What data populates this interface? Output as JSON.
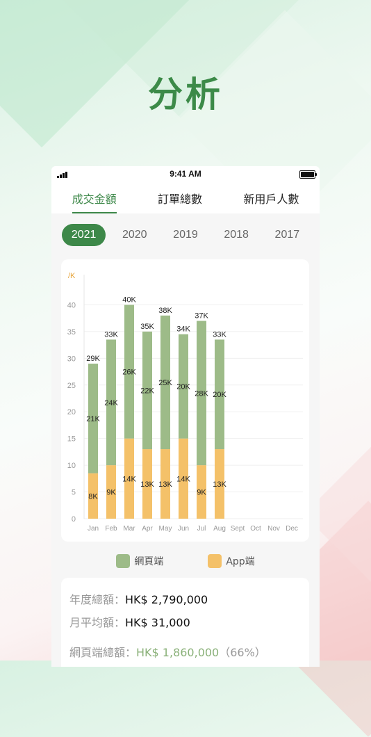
{
  "hero_title": "分析",
  "status": {
    "time": "9:41 AM"
  },
  "tabs": [
    "成交金額",
    "訂單總數",
    "新用戶人數"
  ],
  "active_tab": 0,
  "years": [
    "2021",
    "2020",
    "2019",
    "2018",
    "2017"
  ],
  "active_year": 0,
  "colors": {
    "accent": "#3d8849",
    "web": "#9dbb88",
    "app": "#f4c169"
  },
  "chart_data": {
    "type": "bar",
    "stacked": true,
    "unit_label": "/K",
    "categories": [
      "Jan",
      "Feb",
      "Mar",
      "Apr",
      "May",
      "Jun",
      "Jul",
      "Aug",
      "Sept",
      "Oct",
      "Nov",
      "Dec"
    ],
    "series": [
      {
        "name": "App端",
        "values": [
          8.5,
          10,
          15,
          13,
          13,
          15,
          10,
          13,
          null,
          null,
          null,
          null
        ],
        "labels": [
          "8K",
          "9K",
          "14K",
          "13K",
          "13K",
          "14K",
          "9K",
          "13K"
        ]
      },
      {
        "name": "網頁端",
        "values": [
          20.5,
          23.5,
          25,
          22,
          25,
          19.5,
          27,
          20.5,
          null,
          null,
          null,
          null
        ],
        "labels": [
          "21K",
          "24K",
          "26K",
          "22K",
          "25K",
          "20K",
          "28K",
          "20K"
        ]
      }
    ],
    "total_labels": [
      "29K",
      "33K",
      "40K",
      "35K",
      "38K",
      "34K",
      "37K",
      "33K"
    ],
    "totals": [
      29,
      33.5,
      40,
      35,
      38,
      34.5,
      37,
      33.5
    ],
    "yticks": [
      0,
      5,
      10,
      15,
      20,
      25,
      30,
      35,
      40
    ],
    "ylim": [
      0,
      45
    ],
    "grid": true,
    "legend_position": "bottom"
  },
  "legend": {
    "web": "網頁端",
    "app": "App端"
  },
  "summary": {
    "annual_label": "年度總額：",
    "annual_value": "HK$ 2,790,000",
    "monthly_label": "月平均額：",
    "monthly_value": "HK$ 31,000",
    "web_label": "網頁端總額：",
    "web_value": "HK$ 1,860,000",
    "web_pct": "（66%）"
  }
}
